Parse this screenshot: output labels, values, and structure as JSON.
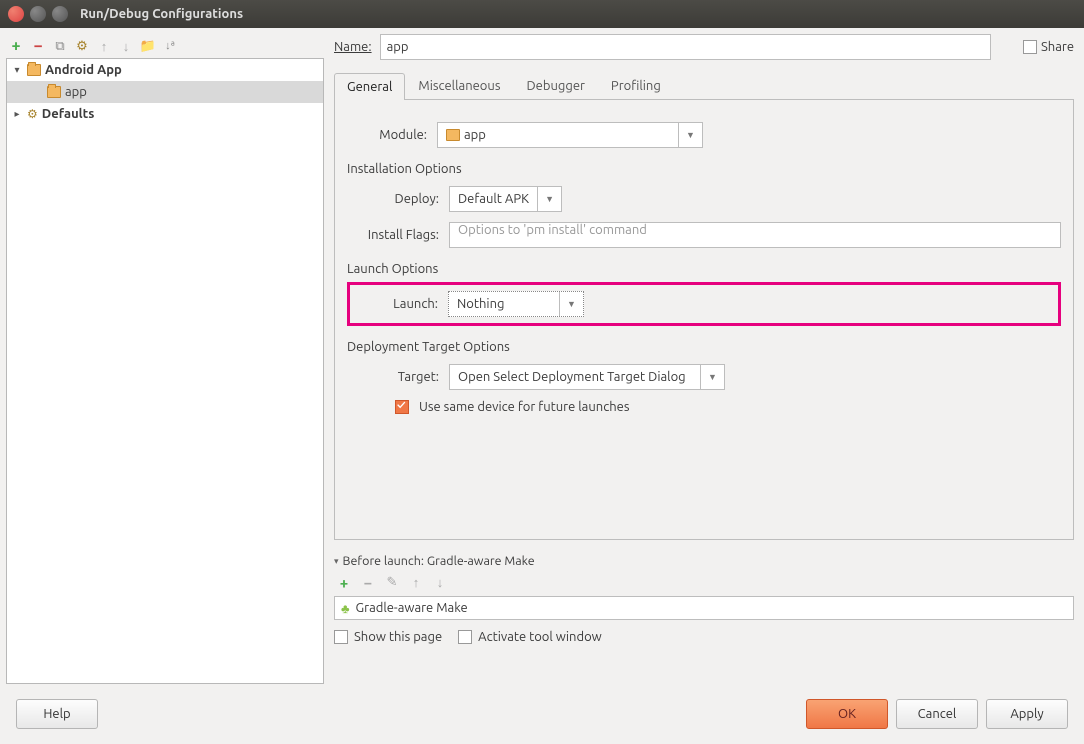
{
  "window": {
    "title": "Run/Debug Configurations"
  },
  "tree": {
    "root1": "Android App",
    "child1": "app",
    "root2": "Defaults"
  },
  "header": {
    "name_label": "Name:",
    "name_value": "app",
    "share_label": "Share"
  },
  "tabs": {
    "general": "General",
    "misc": "Miscellaneous",
    "debugger": "Debugger",
    "profiling": "Profiling"
  },
  "form": {
    "module_label": "Module:",
    "module_letter": "M",
    "module_value": "app",
    "install_hdr": "Installation Options",
    "deploy_label": "Deploy:",
    "deploy_letter": "D",
    "deploy_value": "Default APK",
    "install_flags_label": "Install Flags:",
    "install_flags_letter": "I",
    "install_flags_placeholder": "Options to 'pm install' command",
    "launch_hdr": "Launch Options",
    "launch_label": "Launch:",
    "launch_letter": "L",
    "launch_value": "Nothing",
    "deploy_target_hdr": "Deployment Target Options",
    "target_label": "Target:",
    "target_letter": "T",
    "target_value": "Open Select Deployment Target Dialog",
    "same_device": "Use same device for future launches"
  },
  "before": {
    "hdr_prefix": "B",
    "hdr_rest": "efore launch: Gradle-aware Make",
    "item": "Gradle-aware Make",
    "show_page": "Show this page",
    "activate_tool": "Activate tool window"
  },
  "footer": {
    "help": "Help",
    "ok": "OK",
    "cancel": "Cancel",
    "apply": "Apply"
  }
}
